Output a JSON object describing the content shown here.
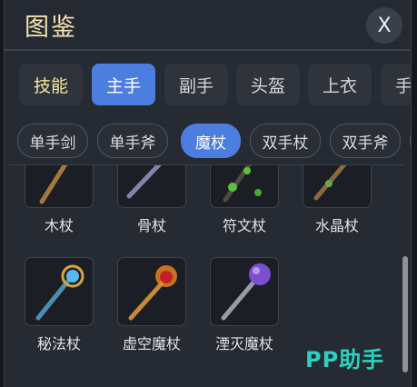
{
  "window": {
    "title": "图鉴",
    "close_label": "X"
  },
  "tabs": [
    {
      "label": "技能",
      "state": "accent"
    },
    {
      "label": "主手",
      "state": "active"
    },
    {
      "label": "副手",
      "state": "normal"
    },
    {
      "label": "头盔",
      "state": "normal"
    },
    {
      "label": "上衣",
      "state": "normal"
    },
    {
      "label": "手套",
      "state": "normal"
    }
  ],
  "subtabs": [
    {
      "label": "单手剑",
      "state": "normal"
    },
    {
      "label": "单手斧",
      "state": "normal"
    },
    {
      "label": "魔杖",
      "state": "active"
    },
    {
      "label": "双手杖",
      "state": "normal"
    },
    {
      "label": "双手斧",
      "state": "normal"
    }
  ],
  "items": [
    {
      "name": "木杖",
      "icon": "wooden-staff-icon"
    },
    {
      "name": "骨杖",
      "icon": "bone-staff-icon"
    },
    {
      "name": "符文杖",
      "icon": "rune-staff-icon"
    },
    {
      "name": "水晶杖",
      "icon": "crystal-staff-icon"
    },
    {
      "name": "秘法杖",
      "icon": "arcane-staff-icon"
    },
    {
      "name": "虚空魔杖",
      "icon": "void-wand-icon"
    },
    {
      "name": "湮灭魔杖",
      "icon": "annihilation-wand-icon"
    }
  ],
  "watermark": "PP助手",
  "colors": {
    "active_tab": "#4c7ee0",
    "accent_text": "#f6e79a",
    "title_text": "#f3e2b2",
    "watermark": "#29d3c0"
  }
}
